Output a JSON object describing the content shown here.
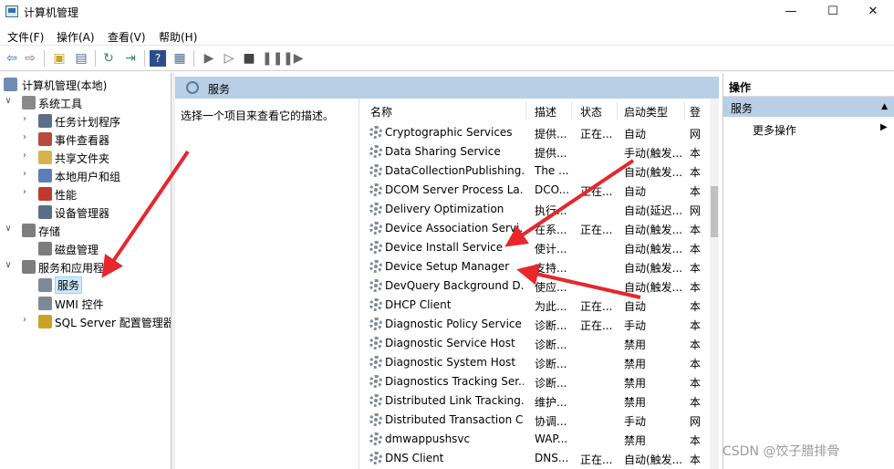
{
  "window": {
    "title": "计算机管理",
    "minimize": "—",
    "maximize": "☐",
    "close": "✕"
  },
  "menu": [
    "文件(F)",
    "操作(A)",
    "查看(V)",
    "帮助(H)"
  ],
  "tree": [
    {
      "label": "计算机管理(本地)",
      "expander": "",
      "icon": "computer-management-icon",
      "color": "#6b8db3"
    },
    {
      "label": "系统工具",
      "expander": "∨",
      "icon": "tools-icon",
      "color": "#8a8a8a"
    },
    {
      "label": "任务计划程序",
      "expander": "›",
      "icon": "clock-icon",
      "color": "#5a6f86"
    },
    {
      "label": "事件查看器",
      "expander": "›",
      "icon": "event-viewer-icon",
      "color": "#b84b3a"
    },
    {
      "label": "共享文件夹",
      "expander": "›",
      "icon": "shared-folder-icon",
      "color": "#d8b24a"
    },
    {
      "label": "本地用户和组",
      "expander": "›",
      "icon": "users-icon",
      "color": "#5b7fb4"
    },
    {
      "label": "性能",
      "expander": "›",
      "icon": "performance-icon",
      "color": "#c0392b"
    },
    {
      "label": "设备管理器",
      "expander": "",
      "icon": "device-manager-icon",
      "color": "#5a6f86"
    },
    {
      "label": "存储",
      "expander": "∨",
      "icon": "storage-icon",
      "color": "#7d7d7d"
    },
    {
      "label": "磁盘管理",
      "expander": "",
      "icon": "disk-icon",
      "color": "#7d7d7d"
    },
    {
      "label": "服务和应用程序",
      "expander": "∨",
      "icon": "services-apps-icon",
      "color": "#7d7d7d"
    },
    {
      "label": "服务",
      "expander": "",
      "icon": "gear-icon",
      "color": "#7d8a96",
      "selected": true
    },
    {
      "label": "WMI 控件",
      "expander": "",
      "icon": "wmi-icon",
      "color": "#7d8a96"
    },
    {
      "label": "SQL Server 配置管理器",
      "expander": "›",
      "icon": "sql-server-icon",
      "color": "#c9a227"
    }
  ],
  "center": {
    "header": "服务",
    "description_prompt": "选择一个项目来查看它的描述。",
    "columns": [
      "名称",
      "描述",
      "状态",
      "启动类型",
      "登"
    ]
  },
  "services": [
    {
      "name": "Cryptographic Services",
      "desc": "提供...",
      "status": "正在...",
      "startup": "自动",
      "logon": "网"
    },
    {
      "name": "Data Sharing Service",
      "desc": "提供...",
      "status": "",
      "startup": "手动(触发...",
      "logon": "本"
    },
    {
      "name": "DataCollectionPublishing...",
      "desc": "The ...",
      "status": "",
      "startup": "自动(触发...",
      "logon": "本"
    },
    {
      "name": "DCOM Server Process La...",
      "desc": "DCO...",
      "status": "正在...",
      "startup": "自动",
      "logon": "本"
    },
    {
      "name": "Delivery Optimization",
      "desc": "执行...",
      "status": "",
      "startup": "自动(延迟...",
      "logon": "网"
    },
    {
      "name": "Device Association Servi...",
      "desc": "在系...",
      "status": "正在...",
      "startup": "自动(触发...",
      "logon": "本"
    },
    {
      "name": "Device Install Service",
      "desc": "使计...",
      "status": "",
      "startup": "自动(触发...",
      "logon": "本"
    },
    {
      "name": "Device Setup Manager",
      "desc": "支持...",
      "status": "",
      "startup": "自动(触发...",
      "logon": "本"
    },
    {
      "name": "DevQuery Background D...",
      "desc": "使应...",
      "status": "",
      "startup": "自动(触发...",
      "logon": "本"
    },
    {
      "name": "DHCP Client",
      "desc": "为此...",
      "status": "正在...",
      "startup": "自动",
      "logon": "本"
    },
    {
      "name": "Diagnostic Policy Service",
      "desc": "诊断...",
      "status": "正在...",
      "startup": "手动",
      "logon": "本"
    },
    {
      "name": "Diagnostic Service Host",
      "desc": "诊断...",
      "status": "",
      "startup": "禁用",
      "logon": "本"
    },
    {
      "name": "Diagnostic System Host",
      "desc": "诊断...",
      "status": "",
      "startup": "禁用",
      "logon": "本"
    },
    {
      "name": "Diagnostics Tracking Ser...",
      "desc": "诊断...",
      "status": "",
      "startup": "禁用",
      "logon": "本"
    },
    {
      "name": "Distributed Link Tracking...",
      "desc": "维护...",
      "status": "",
      "startup": "禁用",
      "logon": "本"
    },
    {
      "name": "Distributed Transaction C...",
      "desc": "协调...",
      "status": "",
      "startup": "手动",
      "logon": "网"
    },
    {
      "name": "dmwappushsvc",
      "desc": "WAP...",
      "status": "",
      "startup": "禁用",
      "logon": "本"
    },
    {
      "name": "DNS Client",
      "desc": "DNS...",
      "status": "正在...",
      "startup": "自动(触发...",
      "logon": "本"
    }
  ],
  "actions": {
    "title": "操作",
    "section": "服务",
    "section_toggle": "▲",
    "more": "更多操作",
    "more_arrow": "▶"
  },
  "watermark": "CSDN @饺子腊排骨",
  "colors": {
    "header_blue": "#b8cfe6",
    "annotation_red": "#e8262b",
    "selection": "#cde8ff"
  }
}
